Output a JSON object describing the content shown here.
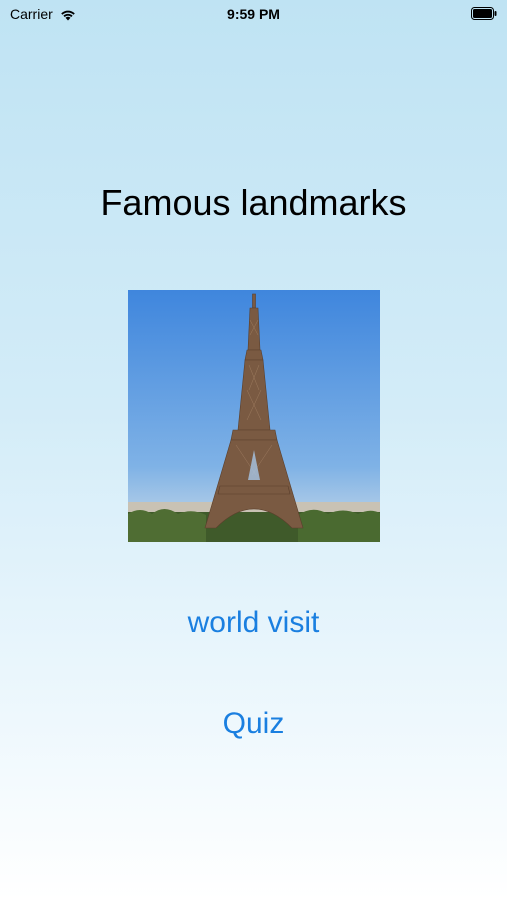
{
  "status_bar": {
    "carrier": "Carrier",
    "time": "9:59 PM"
  },
  "title": "Famous landmarks",
  "image": {
    "subject": "eiffel-tower"
  },
  "buttons": {
    "world_visit": "world visit",
    "quiz": "Quiz"
  },
  "colors": {
    "accent": "#1a7fe0",
    "sky": "#4a90df"
  }
}
